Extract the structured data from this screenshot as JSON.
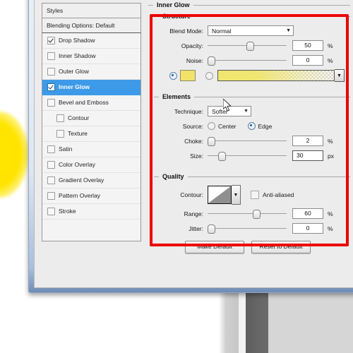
{
  "app": {
    "dialog_title": "Inner Glow"
  },
  "styles_panel": {
    "header": "Styles",
    "blending_options": "Blending Options: Default",
    "items": [
      {
        "label": "Drop Shadow",
        "checked": true,
        "indent": false,
        "selected": false
      },
      {
        "label": "Inner Shadow",
        "checked": false,
        "indent": false,
        "selected": false
      },
      {
        "label": "Outer Glow",
        "checked": false,
        "indent": false,
        "selected": false
      },
      {
        "label": "Inner Glow",
        "checked": true,
        "indent": false,
        "selected": true
      },
      {
        "label": "Bevel and Emboss",
        "checked": false,
        "indent": false,
        "selected": false
      },
      {
        "label": "Contour",
        "checked": false,
        "indent": true,
        "selected": false
      },
      {
        "label": "Texture",
        "checked": false,
        "indent": true,
        "selected": false
      },
      {
        "label": "Satin",
        "checked": false,
        "indent": false,
        "selected": false
      },
      {
        "label": "Color Overlay",
        "checked": false,
        "indent": false,
        "selected": false
      },
      {
        "label": "Gradient Overlay",
        "checked": false,
        "indent": false,
        "selected": false
      },
      {
        "label": "Pattern Overlay",
        "checked": false,
        "indent": false,
        "selected": false
      },
      {
        "label": "Stroke",
        "checked": false,
        "indent": false,
        "selected": false
      }
    ]
  },
  "structure": {
    "group_label": "Structure",
    "blend_mode_label": "Blend Mode:",
    "blend_mode_value": "Normal",
    "opacity_label": "Opacity:",
    "opacity_value": "50",
    "opacity_unit": "%",
    "noise_label": "Noise:",
    "noise_value": "0",
    "noise_unit": "%",
    "fill_type": "color",
    "color_swatch": "#f2e26a",
    "gradient_colors": "#f0e66e"
  },
  "elements": {
    "group_label": "Elements",
    "technique_label": "Technique:",
    "technique_value": "Softer",
    "source_label": "Source:",
    "source_center": "Center",
    "source_edge": "Edge",
    "source_selected": "Edge",
    "choke_label": "Choke:",
    "choke_value": "2",
    "choke_unit": "%",
    "size_label": "Size:",
    "size_value": "30",
    "size_unit": "px"
  },
  "quality": {
    "group_label": "Quality",
    "contour_label": "Contour:",
    "anti_aliased_label": "Anti-aliased",
    "anti_aliased_checked": false,
    "range_label": "Range:",
    "range_value": "60",
    "range_unit": "%",
    "jitter_label": "Jitter:",
    "jitter_value": "0",
    "jitter_unit": "%"
  },
  "buttons": {
    "make_default": "Make Default",
    "reset_to_default": "Reset to Default"
  },
  "annotation": {
    "highlight_color": "#ee0000"
  },
  "colors": {
    "selection_blue": "#3d9ae8",
    "panel_bg": "#ececec",
    "glow_yellow": "#ffe600"
  }
}
